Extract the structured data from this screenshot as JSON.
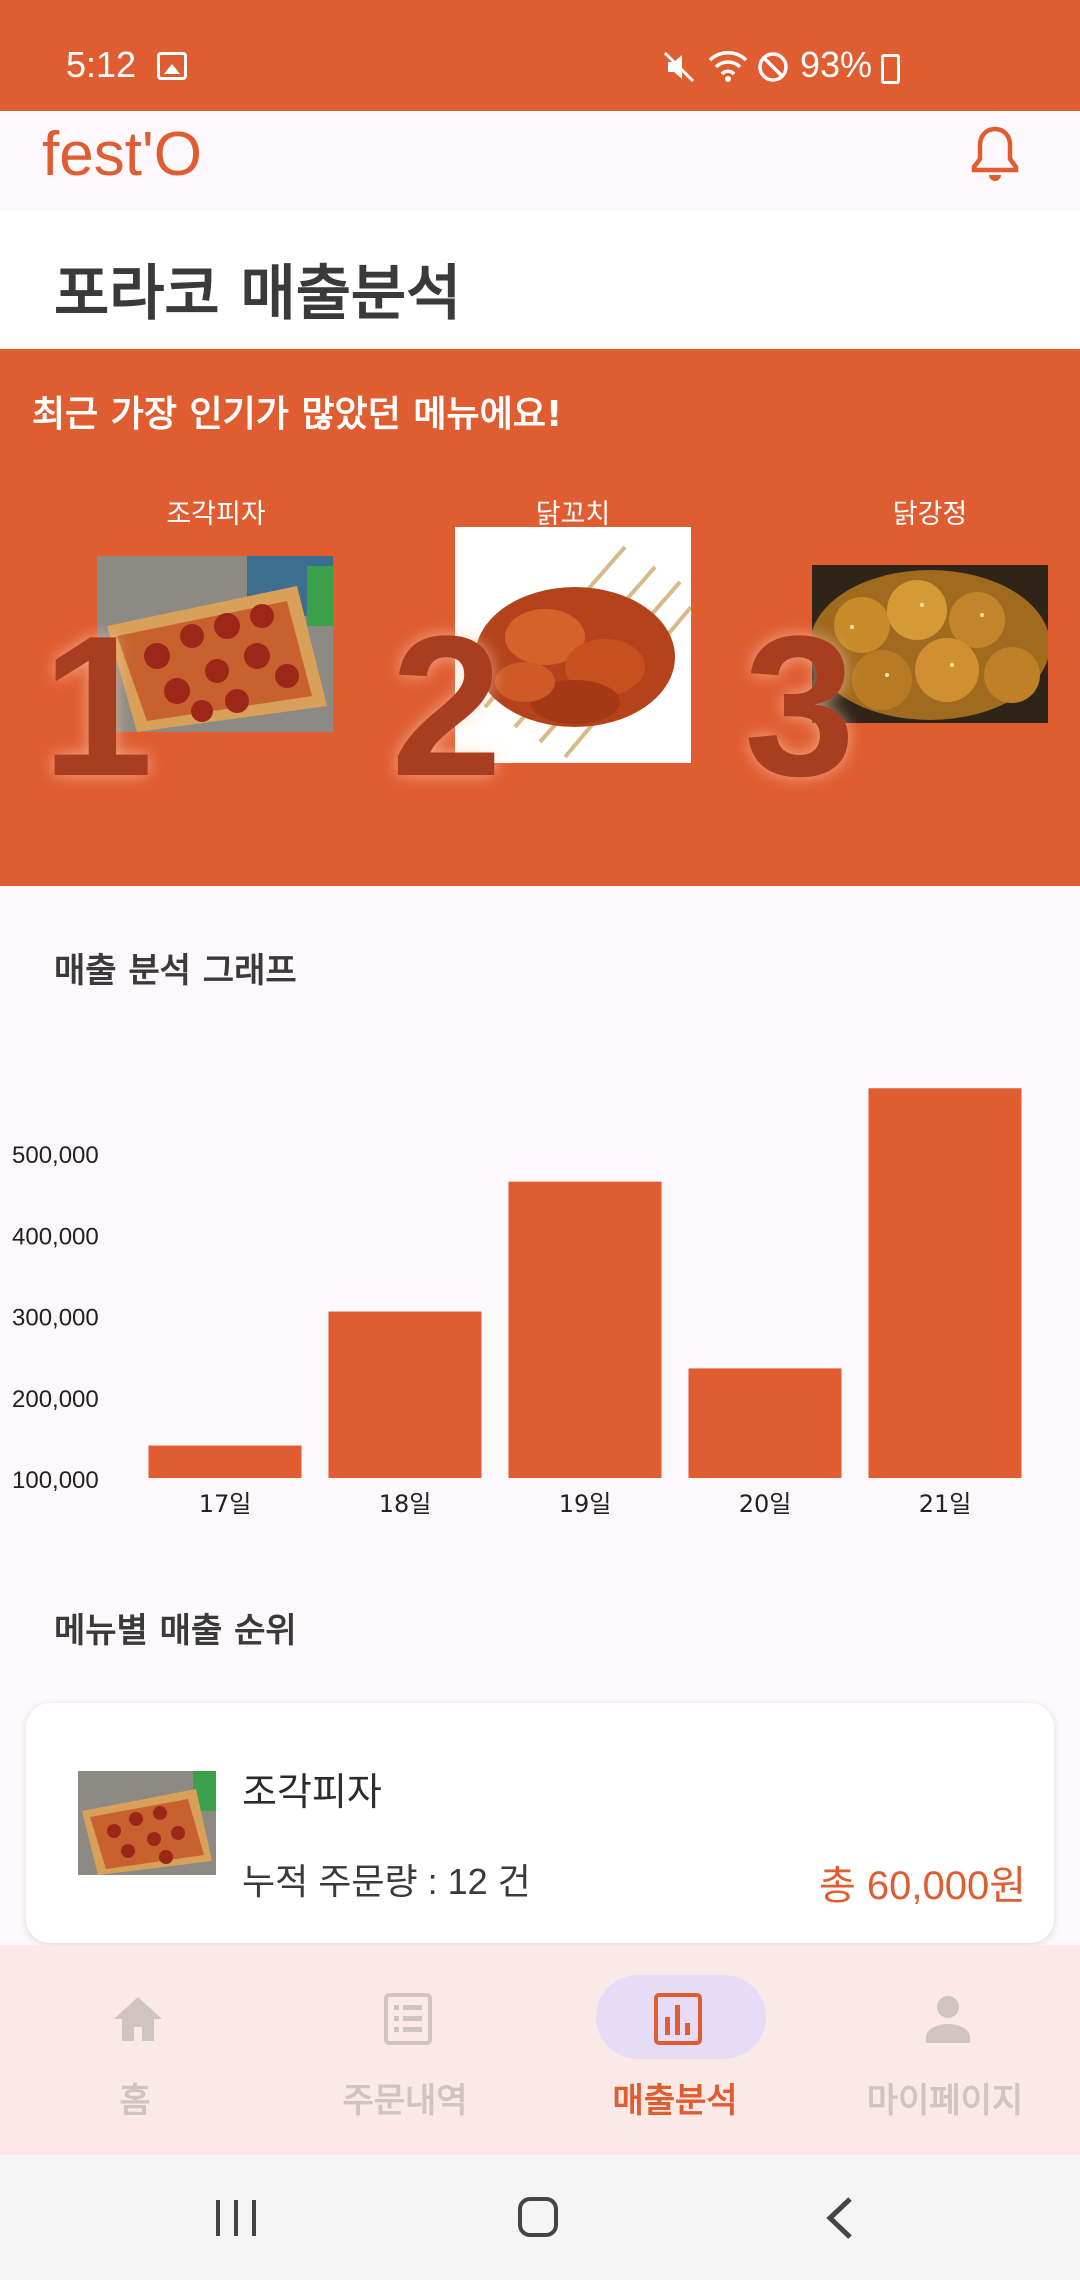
{
  "status_bar": {
    "time": "5:12",
    "battery": "93%"
  },
  "app": {
    "logo": "fest'O"
  },
  "page": {
    "title": "포라코 매출분석"
  },
  "popular": {
    "title": "최근 가장 인기가 많았던 메뉴에요!",
    "items": [
      {
        "rank": "1",
        "name": "조각피자"
      },
      {
        "rank": "2",
        "name": "닭꼬치"
      },
      {
        "rank": "3",
        "name": "닭강정"
      }
    ]
  },
  "chart_section": {
    "title": "매출 분석 그래프"
  },
  "chart_data": {
    "type": "bar",
    "categories": [
      "17일",
      "18일",
      "19일",
      "20일",
      "21일"
    ],
    "values": [
      140000,
      305000,
      465000,
      235000,
      580000
    ],
    "yticks": [
      "100,000",
      "200,000",
      "300,000",
      "400,000",
      "500,000"
    ],
    "ylim": [
      100000,
      600000
    ],
    "color": "#e05c31",
    "grid": false
  },
  "ranking": {
    "title": "메뉴별 매출 순위",
    "items": [
      {
        "name": "조각피자",
        "count": "누적 주문량 : 12 건",
        "total": "총 60,000원"
      }
    ]
  },
  "bottom_nav": {
    "items": [
      {
        "label": "홈",
        "icon": "home-icon"
      },
      {
        "label": "주문내역",
        "icon": "order-list-icon"
      },
      {
        "label": "매출분석",
        "icon": "chart-icon",
        "active": true
      },
      {
        "label": "마이페이지",
        "icon": "person-icon"
      }
    ]
  },
  "colors": {
    "brand": "#e05c31",
    "rank_number": "#a83d1f",
    "nav_active_pill": "#e7dcf7"
  }
}
